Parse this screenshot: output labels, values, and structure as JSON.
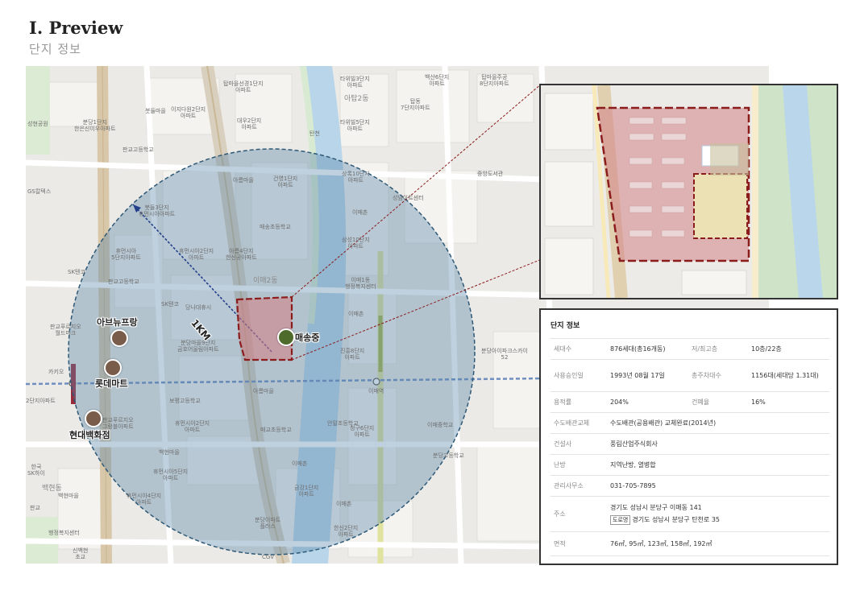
{
  "header": {
    "title": "Ⅰ. Preview",
    "subtitle": "단지 정보"
  },
  "map": {
    "distance_label": "1KM",
    "markers": [
      {
        "label": "매송중",
        "color": "#4f6b2c"
      },
      {
        "label": "아브뉴프랑",
        "color": "#7a5c4b"
      },
      {
        "label": "롯데마트",
        "color": "#7a5c4b"
      },
      {
        "label": "현대백화점",
        "color": "#7a5c4b"
      }
    ],
    "labels": [
      "붓들마을",
      "분당1단지\n한은신이우아파트",
      "성현공원",
      "판교고등학교",
      "이지다원2단지\n아파트",
      "탑마을선경1단지\n아파트",
      "대우2단지\n아파트",
      "타위빌3단지\n아파트",
      "아탑2동",
      "타위빌5단지\n아파트",
      "탑동\n7단지아파트",
      "백산6단지\n아파트",
      "탑마을주공\n8단지아파트",
      "탄천",
      "아름마을",
      "건영1단지\n아파트",
      "매송초등학교",
      "상록10단지\n아파트",
      "중앙도서관",
      "이매촌",
      "GS칼텍스",
      "봇들3단지\n휴먼시아아파트",
      "성남아트센터",
      "삼성10단지\n아파트",
      "휴먼시아\n5단지아파트",
      "휴먼시아2단지\n아파트",
      "아름4단지\n한신공아파트",
      "이매2동",
      "이매1동\n행정복지센터",
      "SK텐코",
      "판교고등학교",
      "SK텐코",
      "당나대휴시",
      "이매촌",
      "판교푸르지오\n월드마크",
      "분당마을9단지\n금호어울림아파트",
      "진흥8단지\n아파트",
      "분당아이파크스카이\n52",
      "이매1동",
      "카키오",
      "아름마을",
      "보평고등학교",
      "휴먼시아2단지\n아파트",
      "판교푸르지오\n그랑블아파트",
      "매교초등학교",
      "안말초등학교",
      "청구6단지\n아파트",
      "이매중학교",
      "백현마을",
      "이매촌",
      "금강1단지\n아파트",
      "휴먼시아5단지\n아파트",
      "휴먼시아4단지\n아파트",
      "이매촌",
      "백현동",
      "백현마을",
      "판교",
      "한신2단지\n아파트",
      "분당이마트\n플러스",
      "행정복지센터",
      "CGV",
      "신백현\n초교",
      "분당고등학교",
      "이매역",
      "2단지아파트",
      "한국\nSK하이"
    ]
  },
  "info": {
    "title": "단지 정보",
    "rows": [
      {
        "k1": "세대수",
        "v1": "876세대(총16개동)",
        "k2": "저/최고층",
        "v2": "10층/22층"
      },
      {
        "k1": "사용승인일",
        "v1": "1993년 08월 17일",
        "k2": "총주차대수",
        "v2": "1156대(세대당 1.31대)"
      },
      {
        "k1": "용적률",
        "v1": "204%",
        "k2": "건폐율",
        "v2": "16%"
      },
      {
        "k1": "수도배관교체",
        "v1": "수도배관(공용배관) 교체완료(2014년)"
      },
      {
        "k1": "건설사",
        "v1": "풍림산업주식회사"
      },
      {
        "k1": "난방",
        "v1": "지역난방, 열병합"
      },
      {
        "k1": "관리사무소",
        "v1": "031-705-7895"
      },
      {
        "k1": "주소",
        "v1": "경기도 성남시 분당구 이매동 141",
        "tag": "도로명",
        "v2line": "경기도 성남시 분당구 탄천로 35"
      },
      {
        "k1": "면적",
        "v1": "76㎡, 95㎡, 123㎡, 158㎡, 192㎡"
      }
    ]
  }
}
